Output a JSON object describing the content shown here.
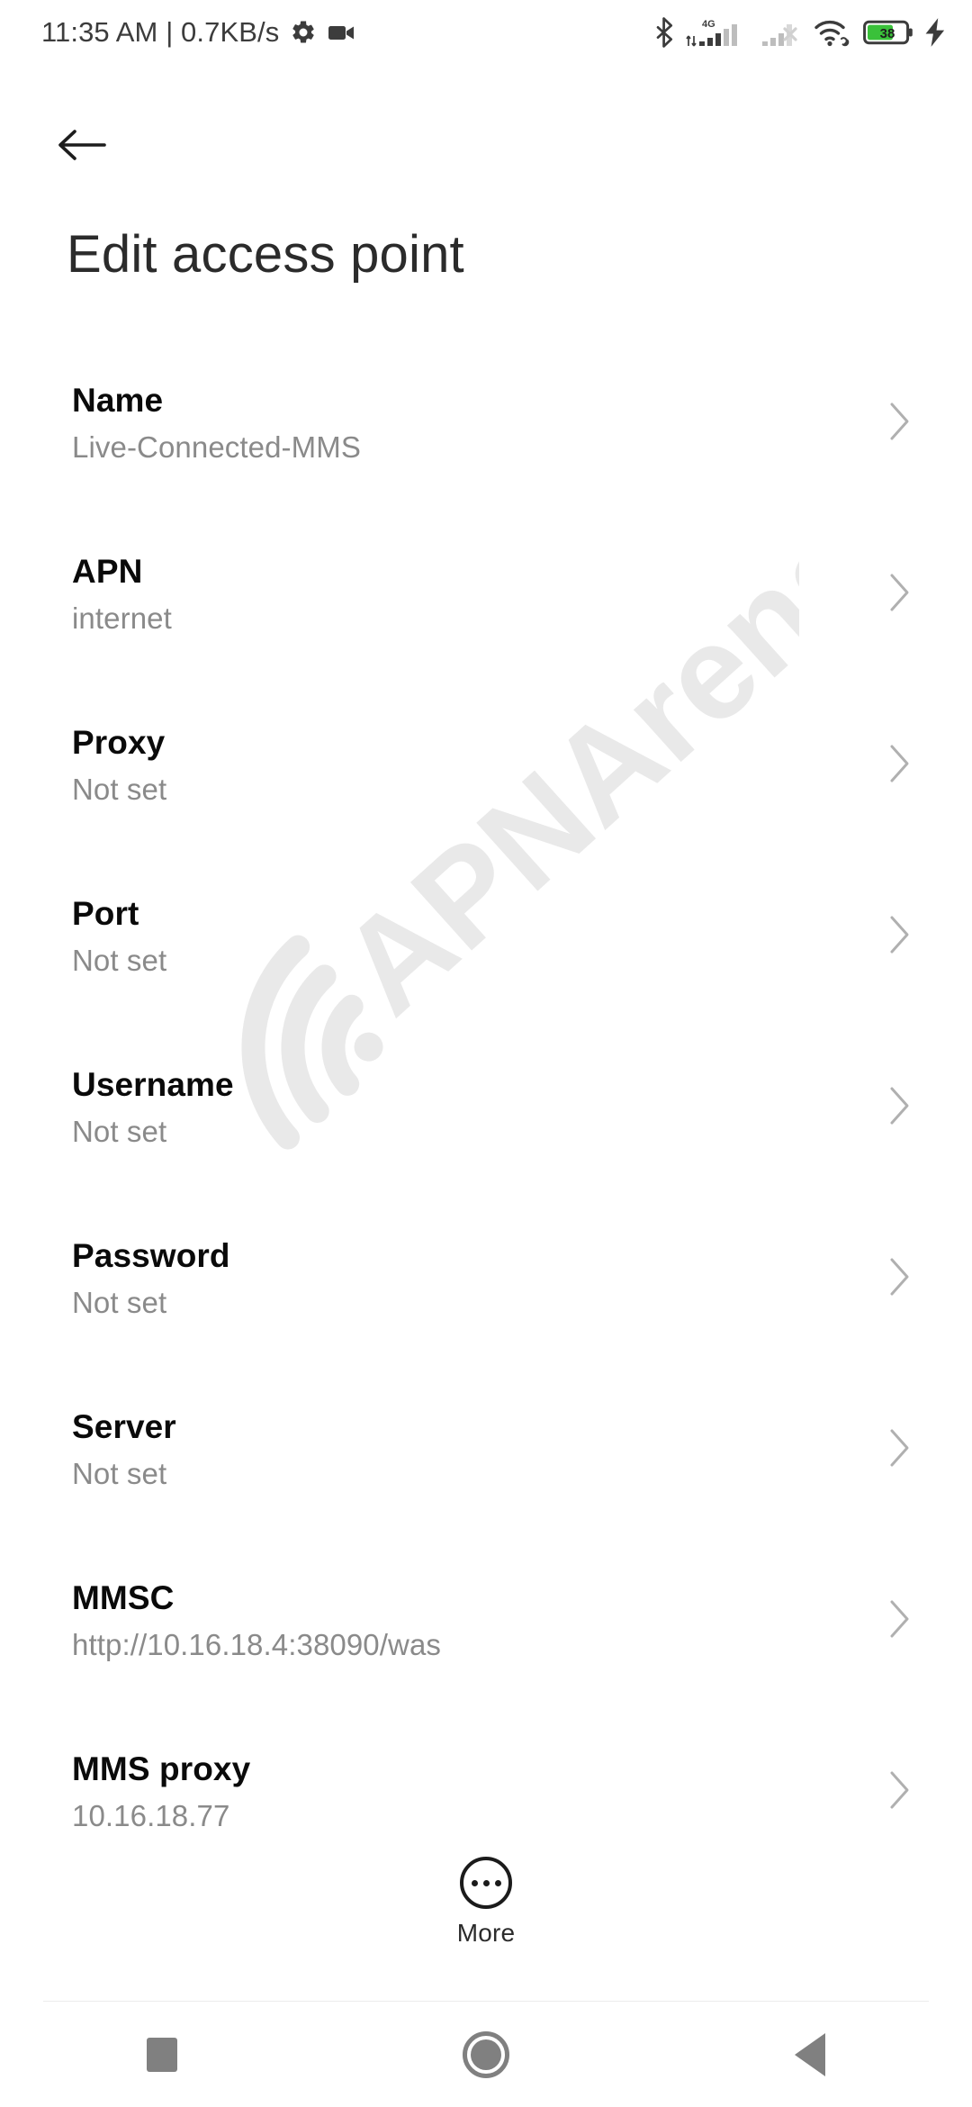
{
  "status_bar": {
    "clock": "11:35 AM | 0.7KB/s",
    "icons_left": [
      "gear-icon",
      "screen-record-icon"
    ],
    "icons_right": [
      "bluetooth-icon",
      "signal-4g-icon",
      "signal-no-service-icon",
      "wifi-icon",
      "battery-icon",
      "charging-bolt-icon"
    ],
    "network_label": "4G",
    "battery_percent": "38",
    "battery_color": "#3ac13a"
  },
  "app_bar": {
    "back_label": "Back",
    "title": "Edit access point"
  },
  "watermark": {
    "text": "APNArena",
    "color": "#e9e9e9"
  },
  "list": {
    "rows": [
      {
        "title": "Name",
        "value": "Live-Connected-MMS"
      },
      {
        "title": "APN",
        "value": "internet"
      },
      {
        "title": "Proxy",
        "value": "Not set"
      },
      {
        "title": "Port",
        "value": "Not set"
      },
      {
        "title": "Username",
        "value": "Not set"
      },
      {
        "title": "Password",
        "value": "Not set"
      },
      {
        "title": "Server",
        "value": "Not set"
      },
      {
        "title": "MMSC",
        "value": "http://10.16.18.4:38090/was"
      },
      {
        "title": "MMS proxy",
        "value": "10.16.18.77"
      }
    ]
  },
  "more_button": {
    "label": "More"
  },
  "nav_bar": {
    "recents_label": "Recents",
    "home_label": "Home",
    "back_label": "Back"
  }
}
